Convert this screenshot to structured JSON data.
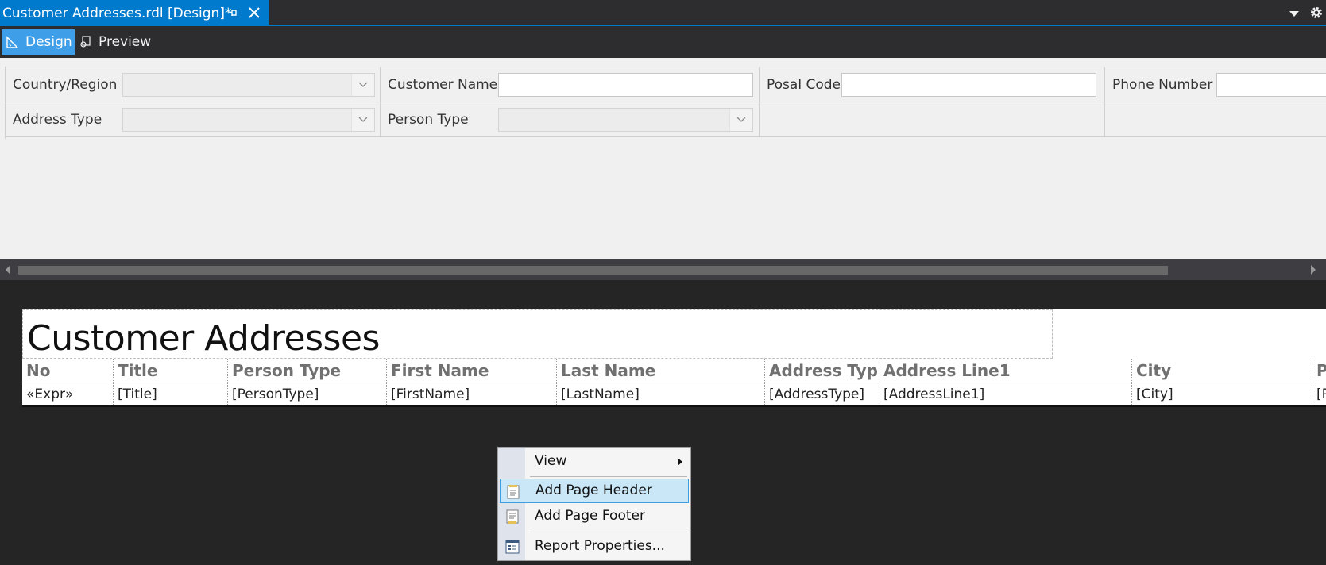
{
  "document_tab": {
    "title": "Customer Addresses.rdl [Design]*"
  },
  "toolbar": {
    "design_label": "Design",
    "preview_label": "Preview"
  },
  "parameters": {
    "country_region_label": "Country/Region",
    "customer_name_label": "Customer Name",
    "postal_code_label": "Posal Code",
    "phone_number_label": "Phone Number",
    "address_type_label": "Address Type",
    "person_type_label": "Person Type"
  },
  "report": {
    "title": "Customer Addresses",
    "columns": [
      {
        "header": "No",
        "field": "«Expr»"
      },
      {
        "header": "Title",
        "field": "[Title]"
      },
      {
        "header": "Person Type",
        "field": "[PersonType]"
      },
      {
        "header": "First Name",
        "field": "[FirstName]"
      },
      {
        "header": "Last Name",
        "field": "[LastName]"
      },
      {
        "header": "Address Typ",
        "field": "[AddressType]"
      },
      {
        "header": "Address Line1",
        "field": "[AddressLine1]"
      },
      {
        "header": "City",
        "field": "[City]"
      },
      {
        "header": "P",
        "field": "[P"
      }
    ]
  },
  "context_menu": {
    "view_label": "View",
    "add_page_header_label": "Add Page Header",
    "add_page_footer_label": "Add Page Footer",
    "report_properties_label": "Report Properties..."
  },
  "colors": {
    "accent": "#007acc",
    "active_button": "#3e9ee8",
    "surface": "#252526",
    "menu_highlight": "#c9e7f7"
  }
}
